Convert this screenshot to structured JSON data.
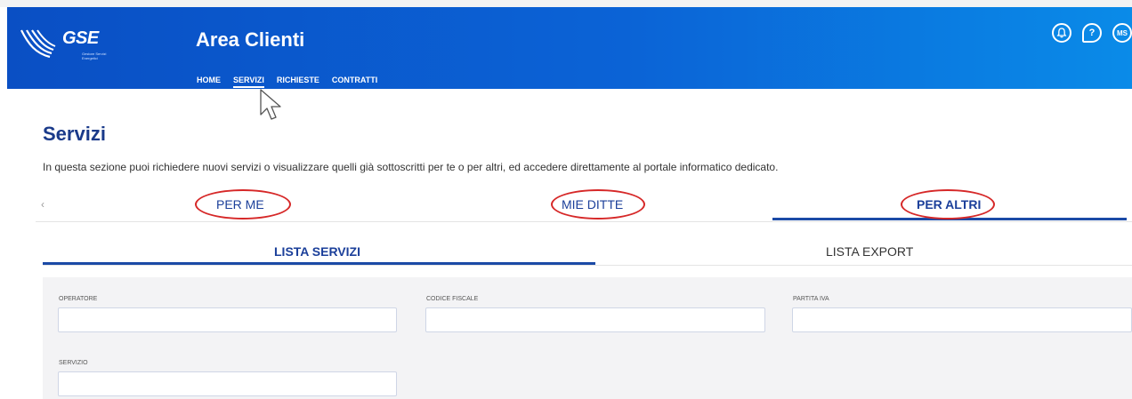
{
  "header": {
    "logo_text": "GSE",
    "logo_sub": "Gestore Servizi Energetici",
    "app_title": "Area Clienti",
    "nav": [
      {
        "label": "HOME"
      },
      {
        "label": "SERVIZI"
      },
      {
        "label": "RICHIESTE"
      },
      {
        "label": "CONTRATTI"
      }
    ],
    "avatar_initials": "MS",
    "help_glyph": "?"
  },
  "page": {
    "title": "Servizi",
    "description": "In questa sezione puoi richiedere nuovi servizi o visualizzare quelli già sottoscritti per te o per altri, ed accedere direttamente al portale informatico dedicato."
  },
  "tabs_primary": [
    {
      "label": "PER ME"
    },
    {
      "label": "MIE DITTE"
    },
    {
      "label": "PER ALTRI"
    }
  ],
  "tabs_primary_prev_glyph": "‹",
  "tabs_secondary": [
    {
      "label": "LISTA SERVIZI"
    },
    {
      "label": "LISTA EXPORT"
    }
  ],
  "filters": {
    "operatore": {
      "label": "OPERATORE",
      "value": ""
    },
    "codice_fiscale": {
      "label": "CODICE FISCALE",
      "value": ""
    },
    "partita_iva": {
      "label": "PARTITA IVA",
      "value": ""
    },
    "servizio": {
      "label": "SERVIZIO",
      "value": ""
    }
  },
  "colors": {
    "header_blue": "#0b63d6",
    "accent_blue": "#1b4aa6",
    "annotation_red": "#d62828"
  }
}
